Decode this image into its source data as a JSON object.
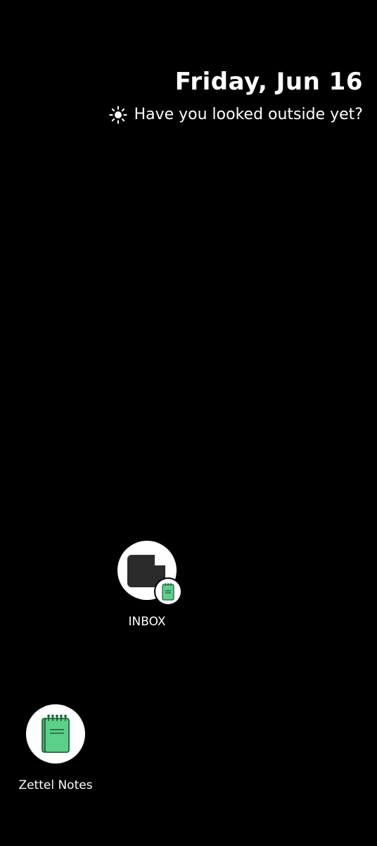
{
  "glance": {
    "date": "Friday, Jun 16",
    "message": "Have you looked outside yet?",
    "weather_icon": "sun-icon"
  },
  "apps": [
    {
      "label": "INBOX",
      "icon": "inbox-shortcut-icon",
      "badge_icon": "zettel-notes-badge-icon"
    },
    {
      "label": "Zettel Notes",
      "icon": "notebook-icon"
    }
  ],
  "colors": {
    "background": "#000000",
    "icon_bg": "#ffffff",
    "notebook_green": "#5cd08a",
    "document_dark": "#2b2b2b"
  }
}
